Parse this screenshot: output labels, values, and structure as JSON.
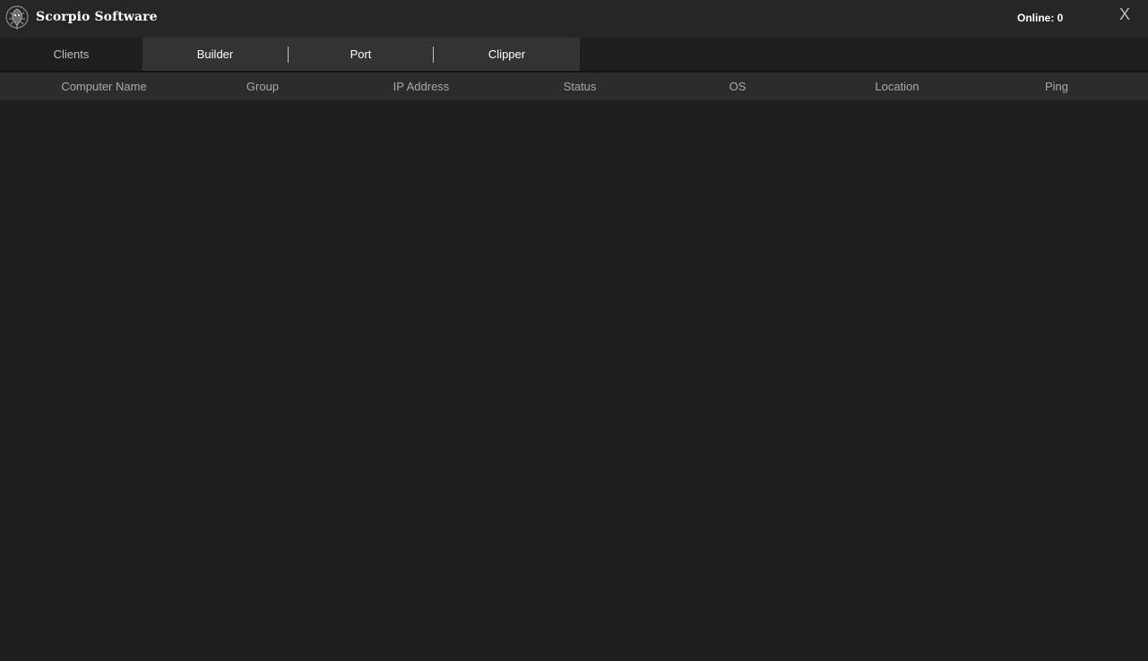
{
  "window": {
    "title": "Scorpio Software",
    "online_label": "Online: 0",
    "close_label": "X",
    "logo_icon": "scorpion-logo-icon"
  },
  "tabs": [
    {
      "label": "Clients",
      "active": false
    },
    {
      "label": "Builder",
      "active": true
    },
    {
      "label": "Port",
      "active": true
    },
    {
      "label": "Clipper",
      "active": true
    }
  ],
  "table": {
    "columns": [
      "Computer Name",
      "Group",
      "IP Address",
      "Status",
      "OS",
      "Location",
      "Ping"
    ],
    "rows": []
  },
  "colors": {
    "background": "#1f1f1f",
    "titlebar": "#262626",
    "tab_background": "#333333",
    "header_background": "#2c2c2c",
    "text": "#ffffff",
    "muted_text": "#a9a9a9"
  }
}
